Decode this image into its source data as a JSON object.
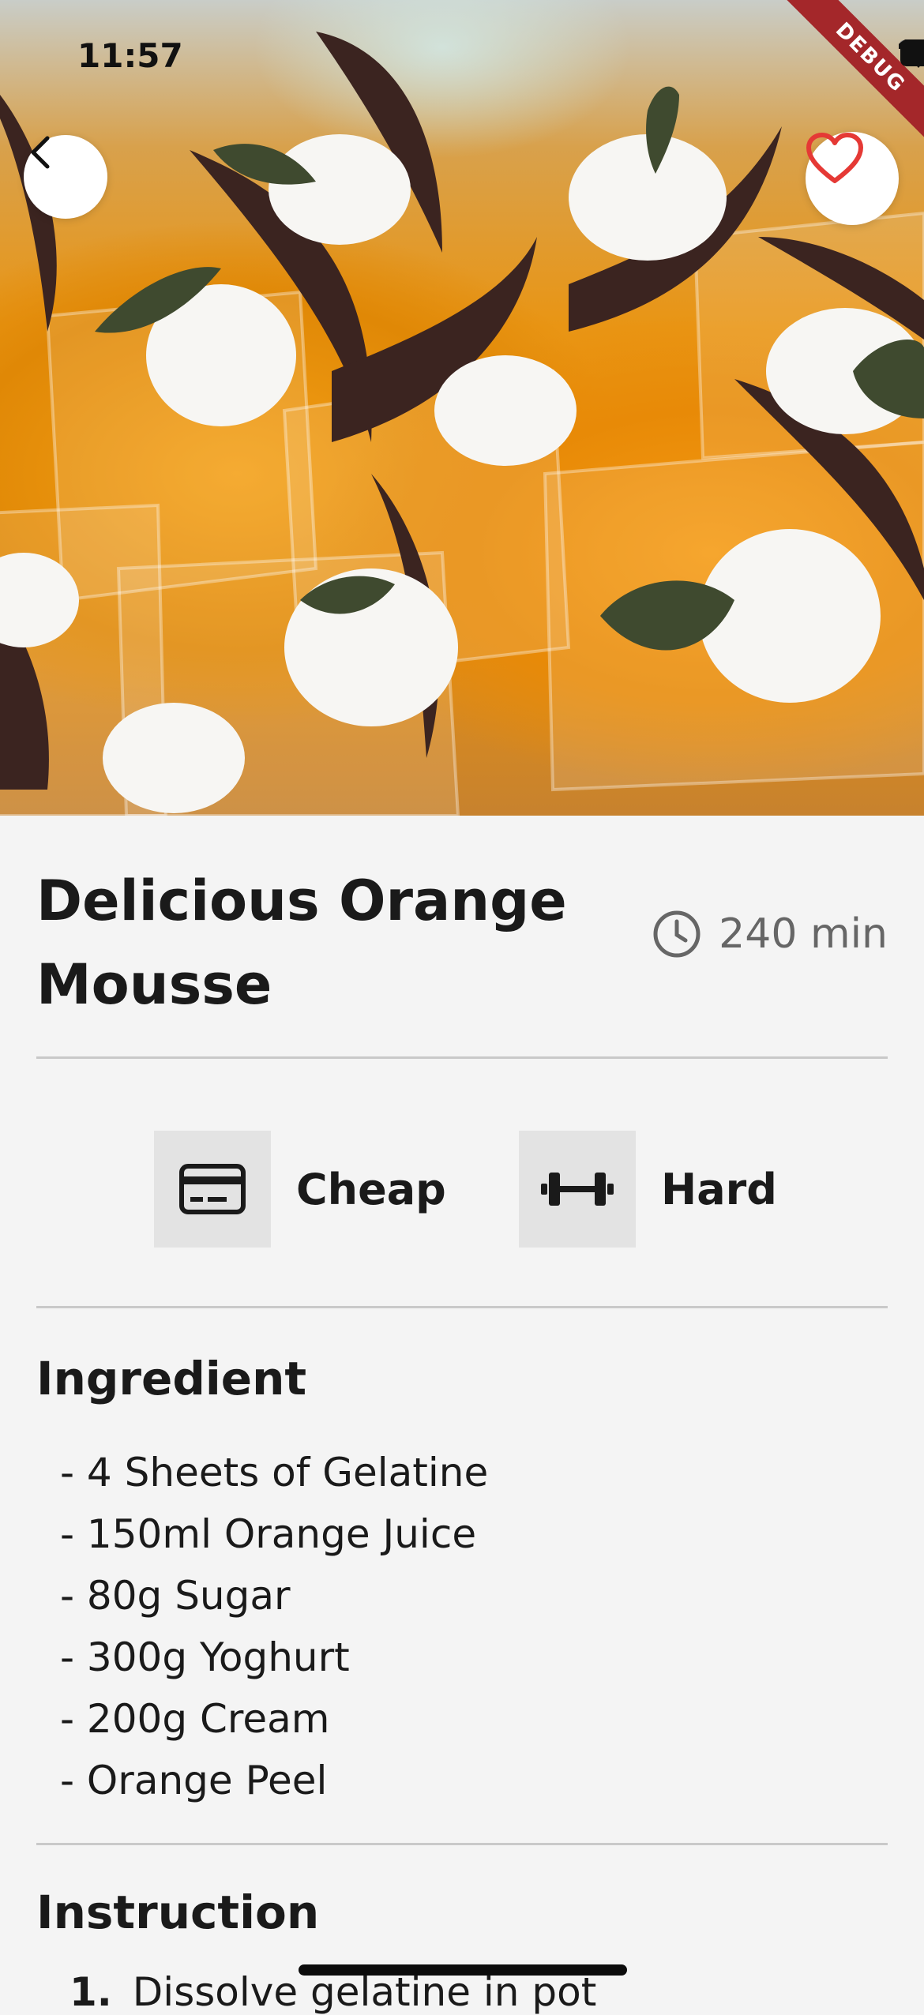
{
  "status_bar": {
    "time": "11:57"
  },
  "debug_banner": "DEBUG",
  "hero": {
    "image_alt": "orange mousse desserts with chocolate and cream"
  },
  "meal": {
    "title": "Delicious Orange Mousse",
    "duration": "240 min",
    "affordability": "Cheap",
    "complexity": "Hard"
  },
  "ingredients": {
    "heading": "Ingredient",
    "items": [
      "- 4 Sheets of Gelatine",
      "- 150ml Orange Juice",
      "- 80g Sugar",
      "- 300g Yoghurt",
      "- 200g Cream",
      "- Orange Peel"
    ]
  },
  "instructions": {
    "heading": "Instruction",
    "first_step_number": "1.",
    "first_step_text": "Dissolve gelatine in pot"
  },
  "icons": {
    "back": "chevron-left-icon",
    "favorite": "heart-outline-icon",
    "clock": "clock-icon",
    "affordability": "credit-card-icon",
    "complexity": "dumbbell-icon"
  },
  "colors": {
    "favorite": "#e53935",
    "debug_ribbon": "#a4272a",
    "background": "#f4f4f4"
  }
}
